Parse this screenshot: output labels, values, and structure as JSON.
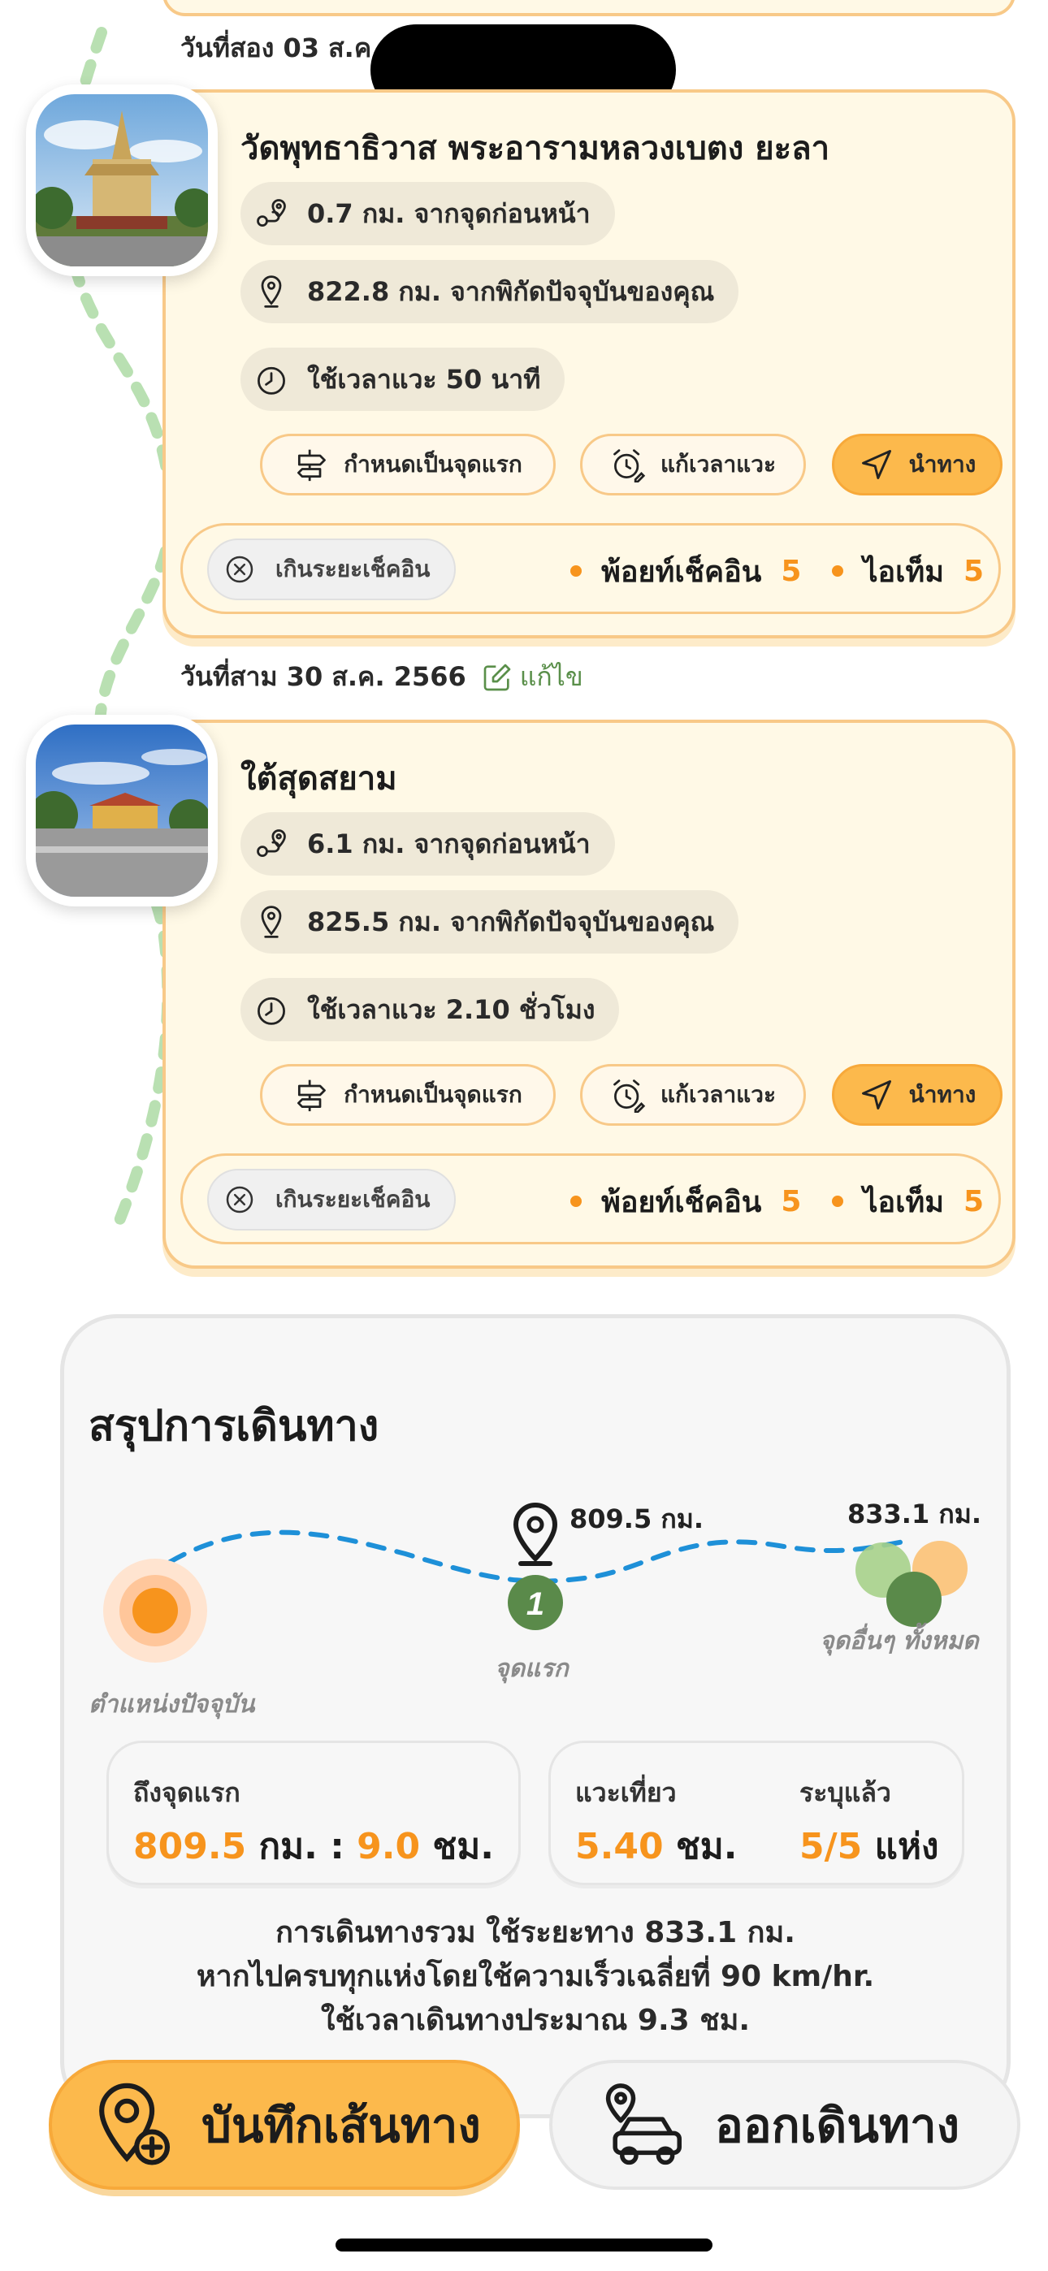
{
  "top_day": {
    "label": "วันที่สอง 03 ส.ค."
  },
  "stops": [
    {
      "title": "วัดพุทธาธิวาส พระอารามหลวงเบตง ยะลา",
      "from_prev": "0.7 กม. จากจุดก่อนหน้า",
      "from_current": "822.8 กม. จากพิกัดปัจจุบันของคุณ",
      "stay_time": "ใช้เวลาแวะ 50 นาที",
      "btn_set_first": "กำหนดเป็นจุดแรก",
      "btn_edit_time": "แก้เวลาแวะ",
      "btn_navigate": "นำทาง",
      "exceed_label": "เกินระยะเช็คอิน",
      "points_label": "พ้อยท์เช็คอิน",
      "points_value": "5",
      "items_label": "ไอเท็ม",
      "items_value": "5"
    },
    {
      "day_label": "วันที่สาม 30 ส.ค. 2566",
      "edit_label": "แก้ไข",
      "title": "ใต้สุดสยาม",
      "from_prev": "6.1 กม. จากจุดก่อนหน้า",
      "from_current": "825.5 กม. จากพิกัดปัจจุบันของคุณ",
      "stay_time": "ใช้เวลาแวะ 2.10 ชั่วโมง",
      "btn_set_first": "กำหนดเป็นจุดแรก",
      "btn_edit_time": "แก้เวลาแวะ",
      "btn_navigate": "นำทาง",
      "exceed_label": "เกินระยะเช็คอิน",
      "points_label": "พ้อยท์เช็คอิน",
      "points_value": "5",
      "items_label": "ไอเท็ม",
      "items_value": "5"
    }
  ],
  "summary": {
    "title": "สรุปการเดินทาง",
    "current_label": "ตำแหน่งปัจจุบัน",
    "first_label": "จุดแรก",
    "first_number": "1",
    "first_distance": "809.5 กม.",
    "others_label": "จุดอื่นๆ ทั้งหมด",
    "others_distance": "833.1 กม.",
    "to_first_label": "ถึงจุดแรก",
    "to_first_km": "809.5",
    "to_first_km_unit": "กม. :",
    "to_first_hr": "9.0",
    "to_first_hr_unit": "ชม.",
    "stopover_label": "แวะเที่ยว",
    "stopover_value": "5.40",
    "stopover_unit": "ชม.",
    "specified_label": "ระบุแล้ว",
    "specified_value": "5/5",
    "specified_unit": "แห่ง",
    "line1": "การเดินทางรวม ใช้ระยะทาง 833.1 กม.",
    "line2": "หากไปครบทุกแห่งโดยใช้ความเร็วเฉลี่ยที่ 90 km/hr.",
    "line3": "ใช้เวลาเดินทางประมาณ 9.3 ชม."
  },
  "actions": {
    "save_route": "บันทึกเส้นทาง",
    "depart": "ออกเดินทาง"
  },
  "colors": {
    "accent_orange": "#f7941d",
    "card_bg": "#fff9e6",
    "card_border": "#f8c988",
    "nav_button": "#fcb94c",
    "dash_blue": "#1e90d8",
    "first_green": "#5a8a4a"
  }
}
